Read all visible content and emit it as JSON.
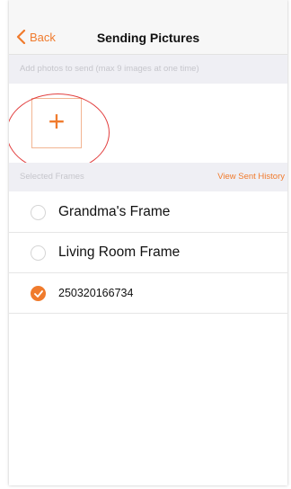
{
  "nav": {
    "back_label": "Back",
    "title": "Sending Pictures"
  },
  "hint": "Add photos to send (max 9 images at one time)",
  "add_button": {
    "glyph": "+"
  },
  "frames_section": {
    "label": "Selected Frames",
    "history_label": "View Sent History"
  },
  "frames": [
    {
      "name": "Grandma's Frame",
      "selected": false
    },
    {
      "name": "Living Room Frame",
      "selected": false
    },
    {
      "name": "250320166734",
      "selected": true
    }
  ],
  "colors": {
    "accent": "#f07b2d",
    "annotation": "#e24040"
  }
}
